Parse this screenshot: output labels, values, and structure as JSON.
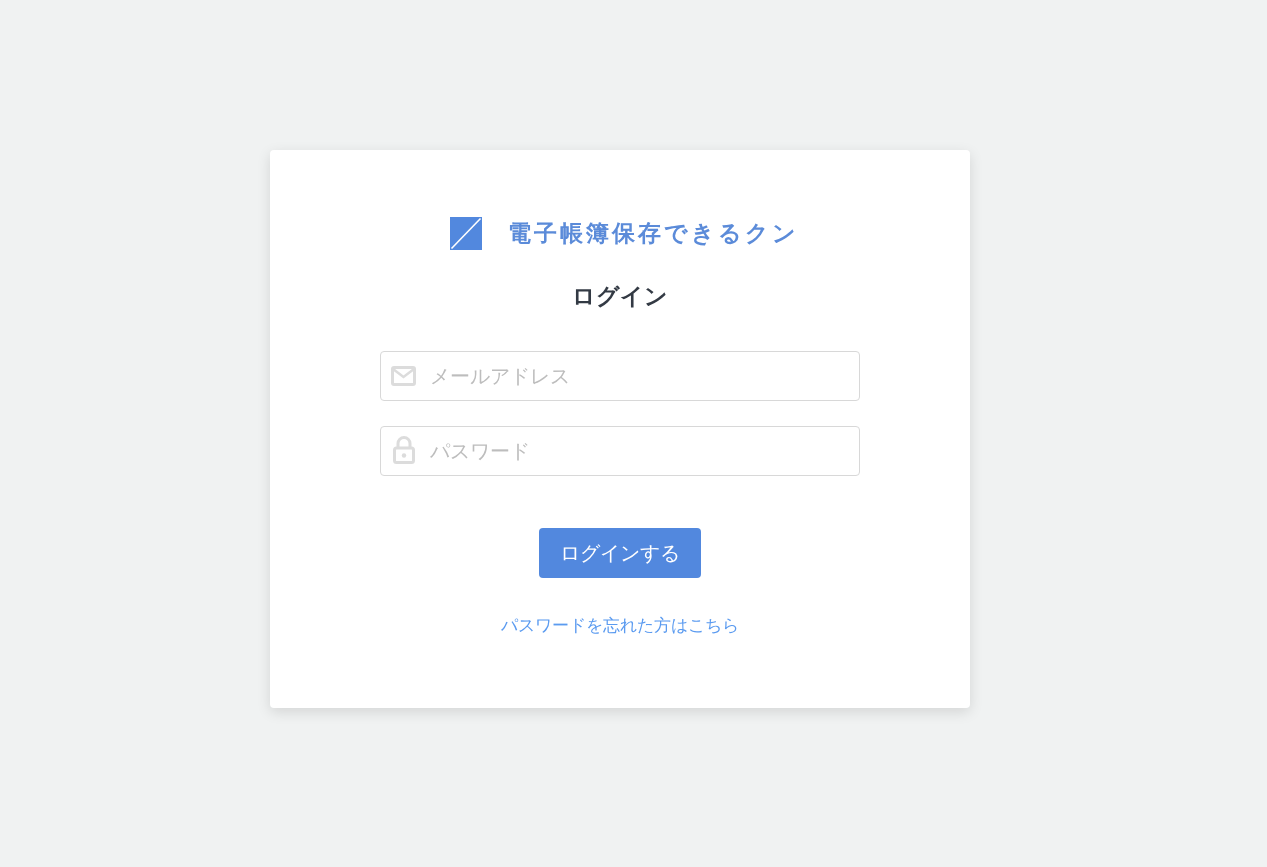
{
  "logo": {
    "name": "電子帳簿保存できるクン"
  },
  "title": "ログイン",
  "fields": [
    {
      "kind": "email",
      "placeholder": "メールアドレス"
    },
    {
      "kind": "password",
      "placeholder": "パスワード"
    }
  ],
  "submit_button": {
    "label": "ログインする"
  },
  "forgot_link": {
    "label": "パスワードを忘れた方はこちら"
  }
}
